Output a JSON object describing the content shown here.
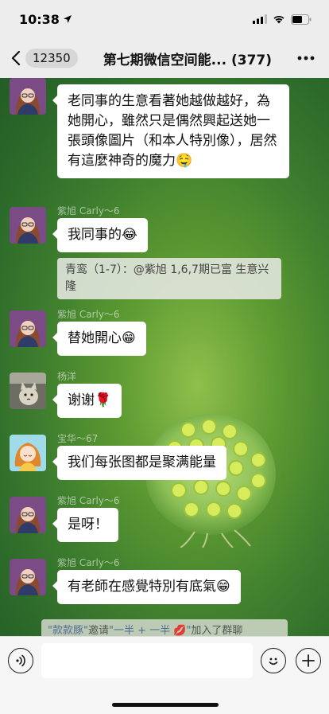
{
  "status_bar": {
    "time": "10:38"
  },
  "header": {
    "unread_count": "12350",
    "title": "第七期微信空间能...",
    "member_count": "(377)"
  },
  "messages": [
    {
      "sender": "",
      "text": "老同事的生意看著她越做越好，為她開心，雖然只是偶然興起送她一張頭像圖片（和本人特別像），居然有這麼神奇的魔力🤤"
    },
    {
      "sender": "紫旭 Carly～6",
      "text": "我同事的😂",
      "quote": "青鸾（1-7）：@紫旭 1,6,7期已富 生意兴隆"
    },
    {
      "sender": "紫旭 Carly～6",
      "text": "替她開心😁"
    },
    {
      "sender": "杨洋",
      "text": "谢谢🌹"
    },
    {
      "sender": "宝华～67",
      "text": "我们每张图都是聚满能量"
    },
    {
      "sender": "紫旭 Carly～6",
      "text": "是呀！"
    },
    {
      "sender": "紫旭 Carly～6",
      "text": "有老師在感覺特別有底氣😁"
    }
  ],
  "system_notice": {
    "inviter": "\"款款豚\"",
    "action": "邀请",
    "invitee": "\"一半 + 一半 💋\"",
    "suffix": "加入了群聊"
  },
  "input": {
    "placeholder": ""
  },
  "colors": {
    "bubble": "#ffffff",
    "link": "#576b95",
    "chat_bg": "#4f8a30"
  },
  "icons": [
    "location-arrow-icon",
    "signal-icon",
    "wifi-icon",
    "battery-icon",
    "back-chevron-icon",
    "more-dots-icon",
    "voice-icon",
    "emoji-icon",
    "plus-icon"
  ]
}
